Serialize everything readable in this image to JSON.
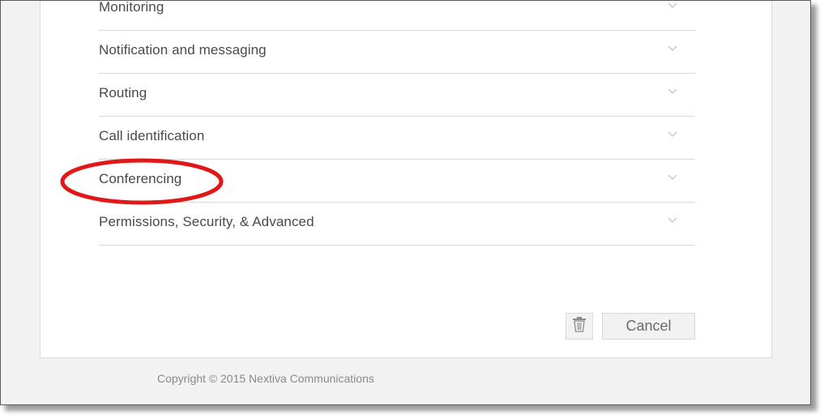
{
  "sections": [
    {
      "label": "Monitoring",
      "icon": "chevron-down-icon"
    },
    {
      "label": "Notification and messaging",
      "icon": "chevron-down-icon"
    },
    {
      "label": "Routing",
      "icon": "chevron-down-icon"
    },
    {
      "label": "Call identification",
      "icon": "chevron-down-icon"
    },
    {
      "label": "Conferencing",
      "icon": "chevron-down-icon",
      "highlighted": true
    },
    {
      "label": "Permissions, Security, & Advanced",
      "icon": "chevron-down-icon"
    }
  ],
  "actions": {
    "delete_icon": "trash-icon",
    "cancel_label": "Cancel"
  },
  "footer": {
    "copyright": "Copyright © 2015 Nextiva Communications"
  },
  "colors": {
    "highlight": "#e01818",
    "page_background": "#f2f2f2",
    "card_background": "#ffffff",
    "divider": "#d9d9d9",
    "label_text": "#4a4a4a"
  }
}
